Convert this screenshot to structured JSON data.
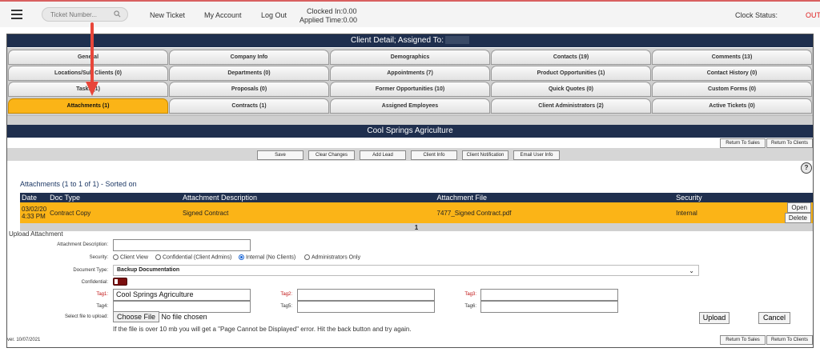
{
  "topbar": {
    "search_placeholder": "Ticket Number...",
    "links": [
      "New Ticket",
      "My Account",
      "Log Out"
    ],
    "clocked_in": "Clocked In:0.00",
    "applied_time": "Applied Time:0.00",
    "clock_status_label": "Clock Status:",
    "clock_status_value": "OUT"
  },
  "client_detail": {
    "title": "Client Detail; Assigned To:"
  },
  "tabs": [
    [
      "General",
      "Company Info",
      "Demographics",
      "Contacts (19)",
      "Comments (13)"
    ],
    [
      "Locations/Sub Clients  (0)",
      "Departments (0)",
      "Appointments (7)",
      "Product Opportunities (1)",
      "Contact History (0)"
    ],
    [
      "Tasks (1)",
      "Proposals (0)",
      "Former Opportunities (10)",
      "Quick Quotes (0)",
      "Custom Forms (0)"
    ],
    [
      "Attachments (1)",
      "Contracts (1)",
      "Assigned Employees",
      "Client Administrators (2)",
      "Active Tickets (0)"
    ]
  ],
  "client_name": "Cool Springs Agriculture",
  "nav_buttons": {
    "return_sales": "Return To Sales",
    "return_clients": "Return To Clients"
  },
  "toolbar": [
    "Save",
    "Clear Changes",
    "Add Lead",
    "Client Info",
    "Client Notification",
    "Email User Info"
  ],
  "help_label": "?",
  "attachments": {
    "title": "Attachments (1 to 1 of 1) - Sorted on",
    "columns": [
      "Date",
      "Doc Type",
      "Attachment Description",
      "Attachment File",
      "Security"
    ],
    "rows": [
      {
        "date_line1": "03/02/20",
        "date_line2": "4:33 PM",
        "doc_type": "Contract Copy",
        "description": "Signed Contract",
        "file": "7477_Signed Contract.pdf",
        "security": "Internal",
        "open_label": "Open",
        "delete_label": "Delete"
      }
    ],
    "page": "1"
  },
  "upload": {
    "title": "Upload Attachment",
    "description_label": "Attachment Description:",
    "security_label": "Security:",
    "security_options": [
      "Client View",
      "Confidential (Client Admins)",
      "Internal (No Clients)",
      "Administrators Only"
    ],
    "security_selected": 2,
    "doctype_label": "Document Type:",
    "doctype_value": "Backup Documentation",
    "confidential_label": "Confidential:",
    "tag1_label": "Tag1:",
    "tag1_value": "Cool Springs Agriculture",
    "tag2_label": "Tag2:",
    "tag3_label": "Tag3:",
    "tag4_label": "Tag4:",
    "tag5_label": "Tag5:",
    "tag6_label": "Tag6:",
    "file_label": "Select file to upload:",
    "choose_file": "Choose File",
    "no_file": "No file chosen",
    "note": "If the file is over 10 mb you will get a \"Page Cannot be Displayed\" error. Hit the back button and try again.",
    "upload_btn": "Upload",
    "cancel_btn": "Cancel"
  },
  "version": "ver. 10/07/2021",
  "colors": {
    "navy": "#1f2f4e",
    "accent": "#fbb417",
    "annotation": "#e8463a"
  }
}
